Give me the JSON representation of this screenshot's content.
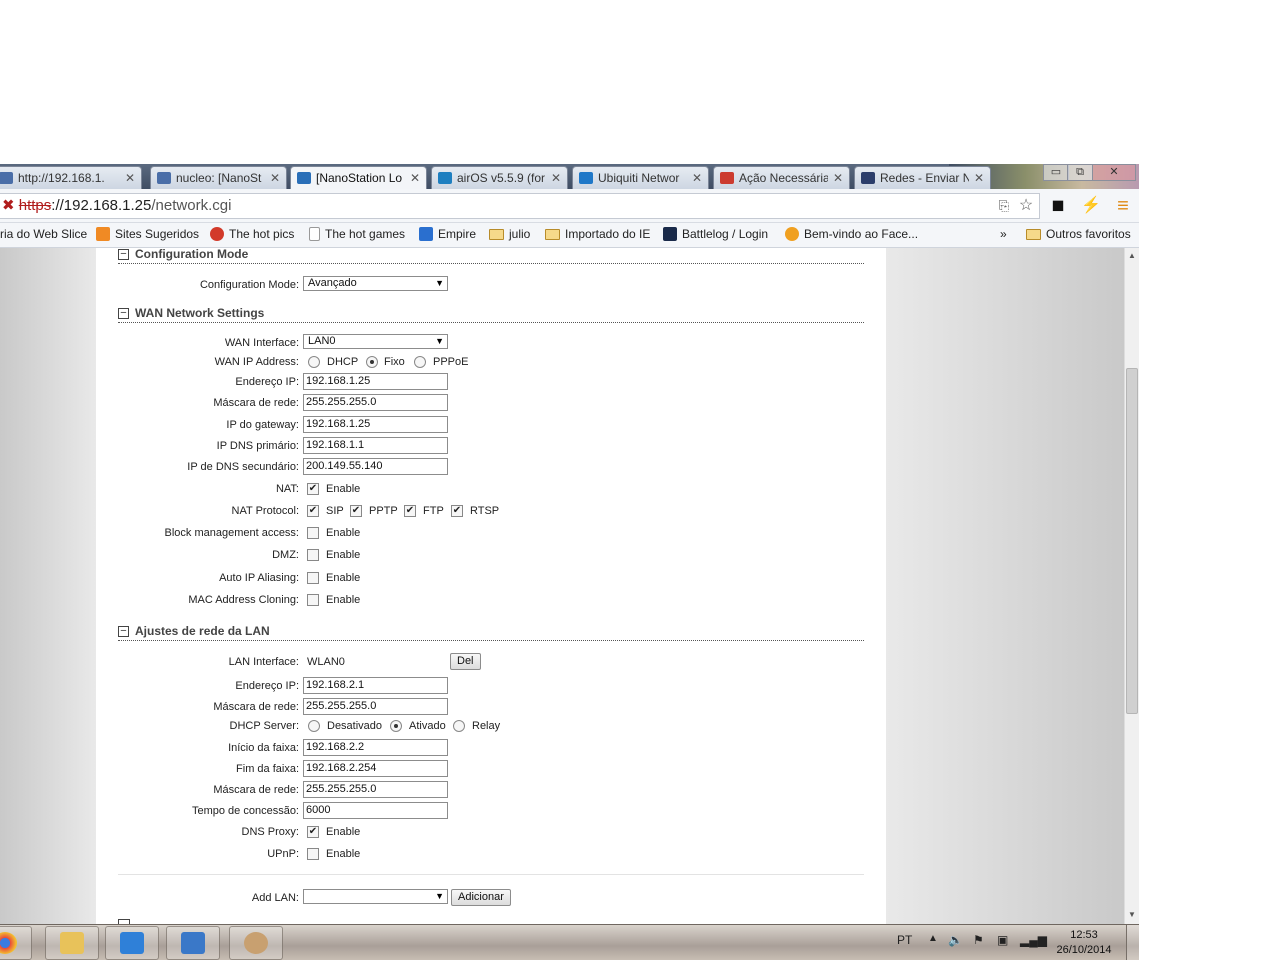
{
  "tabs": [
    {
      "title": "http://192.168.1.",
      "favicon_color": "#4a6ea8",
      "close": "✕"
    },
    {
      "title": "nucleo: [NanoSt",
      "favicon_color": "#4a6ea8",
      "close": "✕"
    },
    {
      "title": "[NanoStation Lo",
      "favicon_color": "#2a6fb8",
      "close": "✕"
    },
    {
      "title": "airOS v5.5.9 (for",
      "favicon_color": "#1e7fc0",
      "close": "✕"
    },
    {
      "title": "Ubiquiti Networ",
      "favicon_color": "#1f78c8",
      "close": "✕"
    },
    {
      "title": "Ação Necessária",
      "favicon_color": "#cc3b2f",
      "close": "✕"
    },
    {
      "title": "Redes - Enviar N",
      "favicon_color": "#2c3e6b",
      "close": "✕"
    }
  ],
  "window_controls": {
    "minimize": "▭",
    "restore": "⧉",
    "close": "✕"
  },
  "address_bar": {
    "scheme": "https",
    "rest": "://192.168.1.25",
    "path": "/network.cgi"
  },
  "bookmarks": [
    {
      "label": "ria do Web Slice",
      "type": "text"
    },
    {
      "label": "Sites Sugeridos",
      "type": "site",
      "color": "#f08a24"
    },
    {
      "label": "The hot pics",
      "type": "site",
      "color": "#d23a2a"
    },
    {
      "label": "The hot games",
      "type": "page",
      "color": "#ffffff"
    },
    {
      "label": "Empire",
      "type": "site",
      "color": "#2a6fcf"
    },
    {
      "label": "julio",
      "type": "folder"
    },
    {
      "label": "Importado do IE",
      "type": "folder"
    },
    {
      "label": "Battlelog / Login",
      "type": "site",
      "color": "#1a2a4a"
    },
    {
      "label": "Bem-vindo ao Face...",
      "type": "site",
      "color": "#f0a020"
    }
  ],
  "bookmarks_overflow": "»",
  "other_bookmarks": "Outros favoritos",
  "sections": {
    "config_mode": {
      "title": "Configuration Mode",
      "toggle": "−"
    },
    "wan": {
      "title": "WAN Network Settings",
      "toggle": "−"
    },
    "lan": {
      "title": "Ajustes de rede da LAN",
      "toggle": "−"
    }
  },
  "config_mode": {
    "label": "Configuration Mode:",
    "value": "Avançado"
  },
  "wan": {
    "interface": {
      "label": "WAN Interface:",
      "value": "LAN0"
    },
    "ip_address": {
      "label": "WAN IP Address:",
      "options": [
        "DHCP",
        "Fixo",
        "PPPoE"
      ],
      "selected": "Fixo"
    },
    "fields": [
      {
        "label": "Endereço IP:",
        "value": "192.168.1.25"
      },
      {
        "label": "Máscara de rede:",
        "value": "255.255.255.0"
      },
      {
        "label": "IP do gateway:",
        "value": "192.168.1.25"
      },
      {
        "label": "IP DNS primário:",
        "value": "192.168.1.1"
      },
      {
        "label": "IP de DNS secundário:",
        "value": "200.149.55.140"
      }
    ],
    "nat": {
      "label": "NAT:",
      "option": "Enable",
      "checked": true
    },
    "nat_protocol": {
      "label": "NAT Protocol:",
      "options": [
        {
          "name": "SIP",
          "checked": true
        },
        {
          "name": "PPTP",
          "checked": true
        },
        {
          "name": "FTP",
          "checked": true
        },
        {
          "name": "RTSP",
          "checked": true
        }
      ]
    },
    "checkbox_rows": [
      {
        "label": "Block management access:",
        "option": "Enable",
        "checked": false
      },
      {
        "label": "DMZ:",
        "option": "Enable",
        "checked": false
      },
      {
        "label": "Auto IP Aliasing:",
        "option": "Enable",
        "checked": false
      },
      {
        "label": "MAC Address Cloning:",
        "option": "Enable",
        "checked": false
      }
    ]
  },
  "lan": {
    "interface": {
      "label": "LAN Interface:",
      "value": "WLAN0",
      "button": "Del"
    },
    "ip": {
      "label": "Endereço IP:",
      "value": "192.168.2.1"
    },
    "mask": {
      "label": "Máscara de rede:",
      "value": "255.255.255.0"
    },
    "dhcp_server": {
      "label": "DHCP Server:",
      "options": [
        "Desativado",
        "Ativado",
        "Relay"
      ],
      "selected": "Ativado"
    },
    "dhcp_fields": [
      {
        "label": "Início da faixa:",
        "value": "192.168.2.2"
      },
      {
        "label": "Fim da faixa:",
        "value": "192.168.2.254"
      },
      {
        "label": "Máscara de rede:",
        "value": "255.255.255.0"
      },
      {
        "label": "Tempo de concessão:",
        "value": "6000"
      }
    ],
    "dns_proxy": {
      "label": "DNS Proxy:",
      "option": "Enable",
      "checked": true
    },
    "upnp": {
      "label": "UPnP:",
      "option": "Enable",
      "checked": false
    },
    "add_lan": {
      "label": "Add LAN:",
      "value": "",
      "button": "Adicionar"
    }
  },
  "taskbar": {
    "apps": [
      {
        "name": "chrome",
        "color": "#d8453a"
      },
      {
        "name": "explorer",
        "color": "#e8c25a"
      },
      {
        "name": "media-player",
        "color": "#2f80d8"
      },
      {
        "name": "control-panel",
        "color": "#3a78c8"
      },
      {
        "name": "paint",
        "color": "#c8a070"
      }
    ],
    "language": "PT",
    "time": "12:53",
    "date": "26/10/2014"
  }
}
